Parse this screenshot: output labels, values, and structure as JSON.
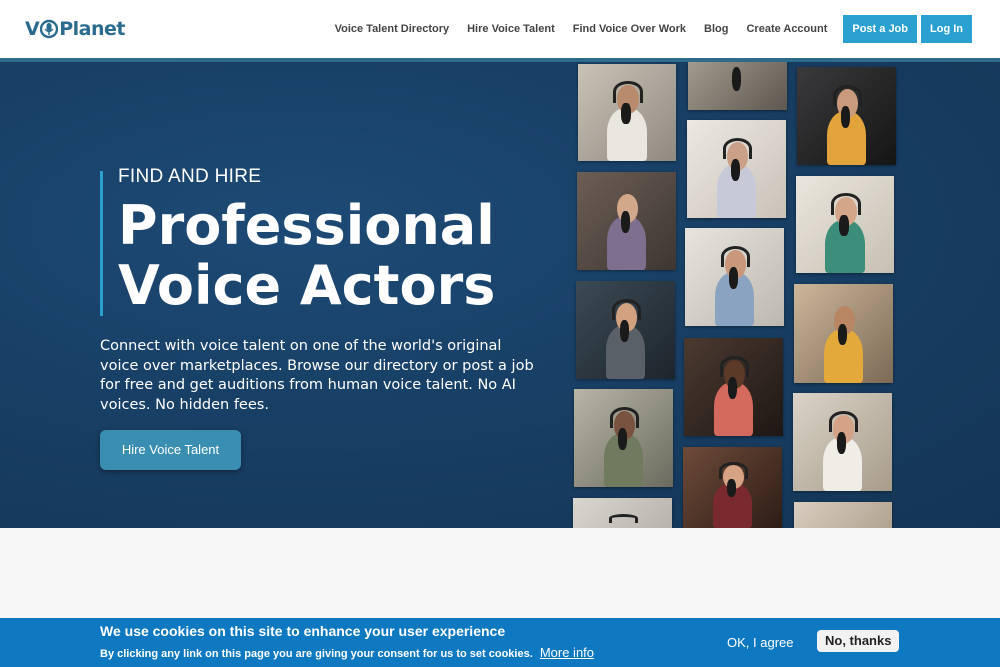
{
  "header": {
    "logo_text_before": "V",
    "logo_text_after": "Planet",
    "nav": [
      {
        "label": "Voice Talent Directory"
      },
      {
        "label": "Hire Voice Talent"
      },
      {
        "label": "Find Voice Over Work"
      },
      {
        "label": "Blog"
      },
      {
        "label": "Create Account"
      }
    ],
    "post_job_label": "Post a Job",
    "login_label": "Log In"
  },
  "hero": {
    "eyebrow": "FIND AND HIRE",
    "headline_line1": "Professional",
    "headline_line2": "Voice Actors",
    "description": "Connect with voice talent on one of the world's original voice over marketplaces. Browse our directory or post a job for free and get auditions from human voice talent. No AI voices. No hidden fees.",
    "cta_label": "Hire Voice Talent"
  },
  "cookie_banner": {
    "title": "We use cookies on this site to enhance your user experience",
    "text": "By clicking any link on this page you are giving your consent for us to set cookies.",
    "more_info_label": "More info",
    "ok_label": "OK, I agree",
    "no_label": "No, thanks"
  },
  "colors": {
    "brand": "#2b6c8e",
    "accent": "#2aa0d0",
    "hero_bg": "#173d62",
    "cookie_bg": "#0e78c0"
  }
}
